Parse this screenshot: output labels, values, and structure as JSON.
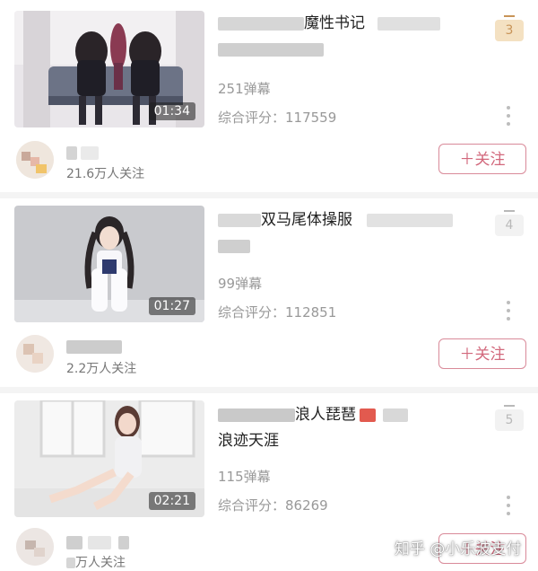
{
  "videos": [
    {
      "rank": "3",
      "duration": "01:34",
      "title_visible": "魔性书记",
      "title_line2_visible": "",
      "danmaku": "251弹幕",
      "score": "综合评分：117559",
      "followers": "21.6万人关注",
      "follow_label": "＋关注"
    },
    {
      "rank": "4",
      "duration": "01:27",
      "title_visible": "双马尾体操服",
      "title_line2_visible": "",
      "danmaku": "99弹幕",
      "score": "综合评分：112851",
      "followers": "2.2万人关注",
      "follow_label": "＋关注"
    },
    {
      "rank": "5",
      "duration": "02:21",
      "title_visible": "浪人琵琶",
      "title_line2_visible": "浪迹天涯",
      "danmaku": "115弹幕",
      "score": "综合评分：86269",
      "followers": "万人关注",
      "follow_label": "＋关注"
    }
  ],
  "watermark": "知乎 @小乐波支付",
  "colors": {
    "accent": "#d2687c",
    "rank_top": "#c89458",
    "muted": "#999999"
  }
}
